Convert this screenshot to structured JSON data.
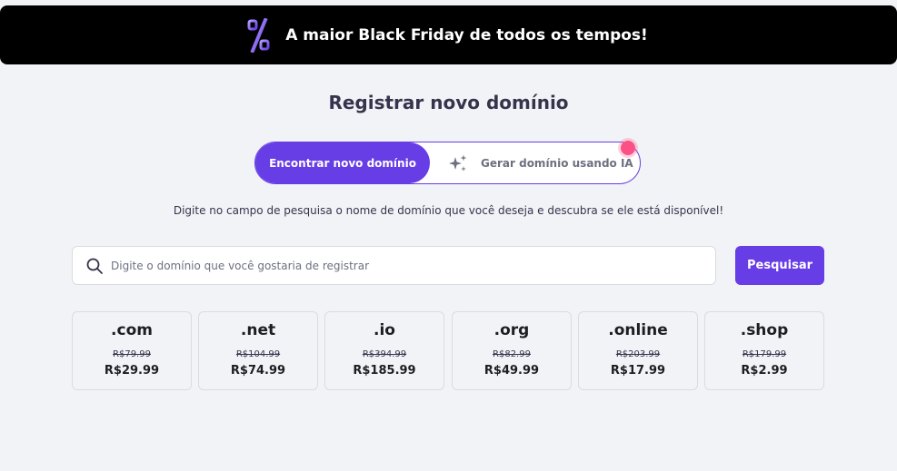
{
  "banner": {
    "text": "A maior Black Friday de todos os tempos!",
    "icon": "percent-icon"
  },
  "page": {
    "title": "Registrar novo domínio",
    "subtitle": "Digite no campo de pesquisa o nome de domínio que você deseja e descubra se ele está disponível!"
  },
  "toggle": {
    "active_label": "Encontrar novo domínio",
    "ai_label": "Gerar domínio usando IA",
    "ai_icon": "sparkle-icon"
  },
  "search": {
    "placeholder": "Digite o domínio que você gostaria de registrar",
    "value": "",
    "button_label": "Pesquisar",
    "icon": "search-icon"
  },
  "colors": {
    "primary": "#673de6",
    "background": "#f2f3f6",
    "banner_bg": "#000000",
    "notification_dot": "#fc5185"
  },
  "tlds": [
    {
      "name": ".com",
      "old_price": "R$79.99",
      "price": "R$29.99"
    },
    {
      "name": ".net",
      "old_price": "R$104.99",
      "price": "R$74.99"
    },
    {
      "name": ".io",
      "old_price": "R$394.99",
      "price": "R$185.99"
    },
    {
      "name": ".org",
      "old_price": "R$82.99",
      "price": "R$49.99"
    },
    {
      "name": ".online",
      "old_price": "R$203.99",
      "price": "R$17.99"
    },
    {
      "name": ".shop",
      "old_price": "R$179.99",
      "price": "R$2.99"
    }
  ]
}
